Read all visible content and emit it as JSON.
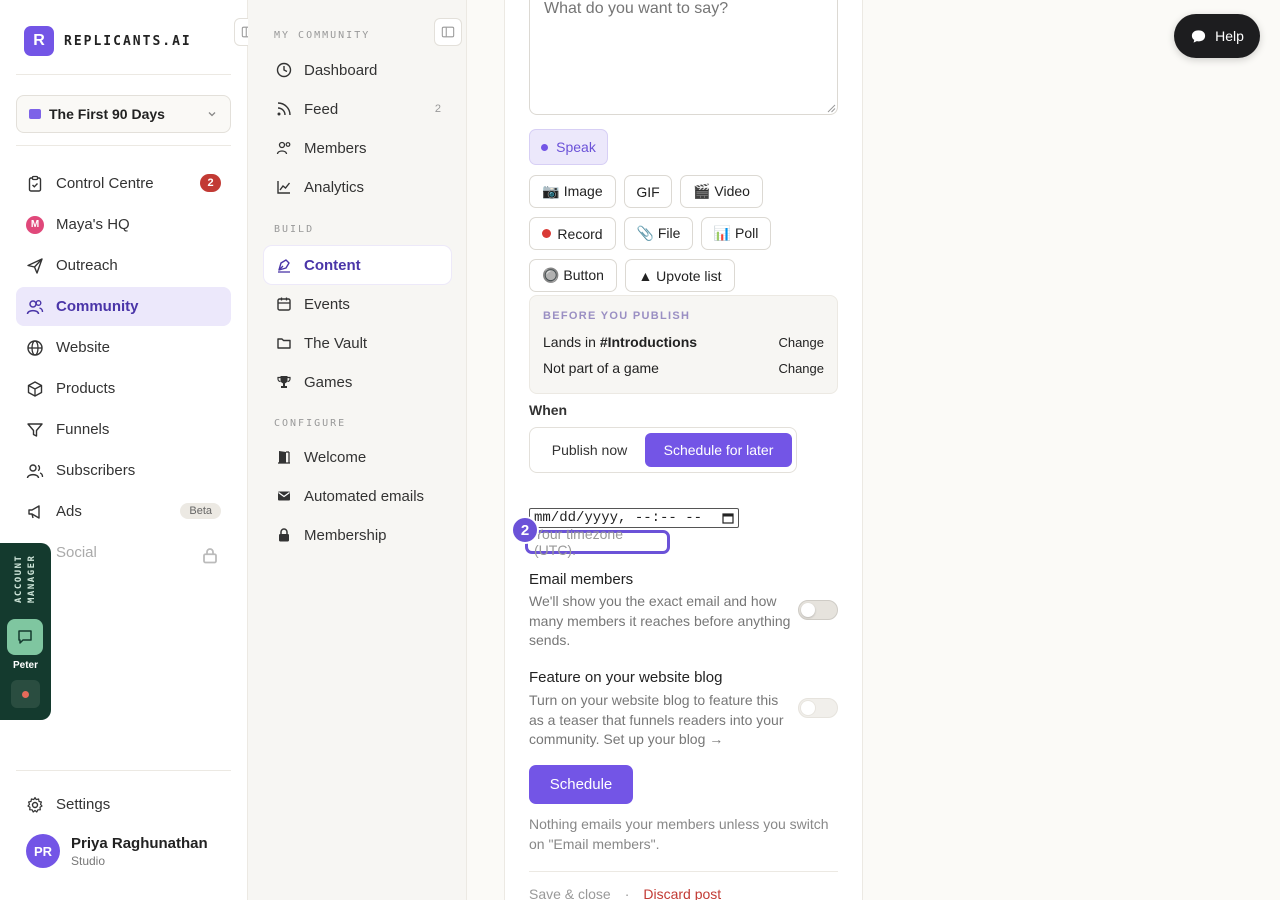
{
  "brand": {
    "logo_letter": "R",
    "name": "REPLICANTS.AI"
  },
  "workspace": {
    "name": "The First 90 Days"
  },
  "nav": {
    "items": [
      {
        "label": "Control Centre",
        "icon": "clipboard-icon",
        "badge": "2"
      },
      {
        "label": "Maya's HQ",
        "icon": "maya-avatar-icon",
        "letter": "M"
      },
      {
        "label": "Outreach",
        "icon": "send-icon"
      },
      {
        "label": "Community",
        "icon": "users-icon",
        "active": true
      },
      {
        "label": "Website",
        "icon": "globe-icon"
      },
      {
        "label": "Products",
        "icon": "box-icon"
      },
      {
        "label": "Funnels",
        "icon": "funnel-icon"
      },
      {
        "label": "Subscribers",
        "icon": "subscribers-icon"
      },
      {
        "label": "Ads",
        "icon": "megaphone-icon",
        "badge": "Beta"
      },
      {
        "label": "Social",
        "icon": "social-icon",
        "locked": true
      }
    ],
    "settings_label": "Settings"
  },
  "user": {
    "initials": "PR",
    "name": "Priya Raghunathan",
    "plan": "Studio"
  },
  "account_manager": {
    "label": "ACCOUNT MANAGER",
    "name": "Peter"
  },
  "subnav": {
    "heading_community": "MY COMMUNITY",
    "heading_build": "BUILD",
    "heading_configure": "CONFIGURE",
    "community": [
      {
        "label": "Dashboard"
      },
      {
        "label": "Feed",
        "count": "2"
      },
      {
        "label": "Members"
      },
      {
        "label": "Analytics"
      }
    ],
    "build": [
      {
        "label": "Content",
        "active": true
      },
      {
        "label": "Events"
      },
      {
        "label": "The Vault"
      },
      {
        "label": "Games"
      }
    ],
    "configure": [
      {
        "label": "Welcome"
      },
      {
        "label": "Automated emails"
      },
      {
        "label": "Membership"
      }
    ]
  },
  "composer": {
    "placeholder": "What do you want to say?",
    "speak_label": "Speak",
    "attachments": {
      "image": "📷 Image",
      "gif": "GIF",
      "video": "🎬 Video",
      "record": "Record",
      "file": "📎 File",
      "poll": "📊 Poll",
      "button": "🔘 Button",
      "upvote": "▲ Upvote list"
    },
    "before_publish": {
      "title": "BEFORE YOU PUBLISH",
      "lands_prefix": "Lands in ",
      "channel": "#Introductions",
      "game_text": "Not part of a game",
      "change_label": "Change"
    },
    "when_label": "When",
    "when_options": {
      "now": "Publish now",
      "later": "Schedule for later"
    },
    "when_selected": "later",
    "datetime_value": "mm/dd/yyyy, --:-- --",
    "timezone_text": "Your timezone (UTC).",
    "step_number": "2",
    "email_members": {
      "title": "Email members",
      "desc": "We'll show you the exact email and how many members it reaches before anything sends.",
      "on": false
    },
    "feature_blog": {
      "title": "Feature on your website blog",
      "desc": "Turn on your website blog to feature this as a teaser that funnels readers into your community. Set up your blog →",
      "on": false
    },
    "schedule_label": "Schedule",
    "note": "Nothing emails your members unless you switch on \"Email members\".",
    "save_close": "Save & close",
    "separator": "·",
    "discard": "Discard post"
  },
  "help": {
    "label": "Help"
  },
  "colors": {
    "accent": "#7355e6",
    "danger": "#c23a34",
    "am_bg": "#143a2e"
  }
}
